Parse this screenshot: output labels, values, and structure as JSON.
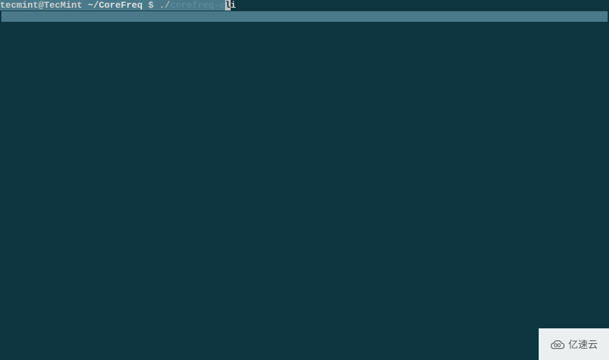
{
  "prompt": {
    "user_host": "tecmint@TecMint",
    "path": "~/CoreFreq",
    "symbol": "$",
    "typed_prefix": "./",
    "completion": "corefreq-c",
    "cursor_char": "l",
    "after_cursor": "i"
  },
  "watermark": {
    "text": "亿速云"
  }
}
